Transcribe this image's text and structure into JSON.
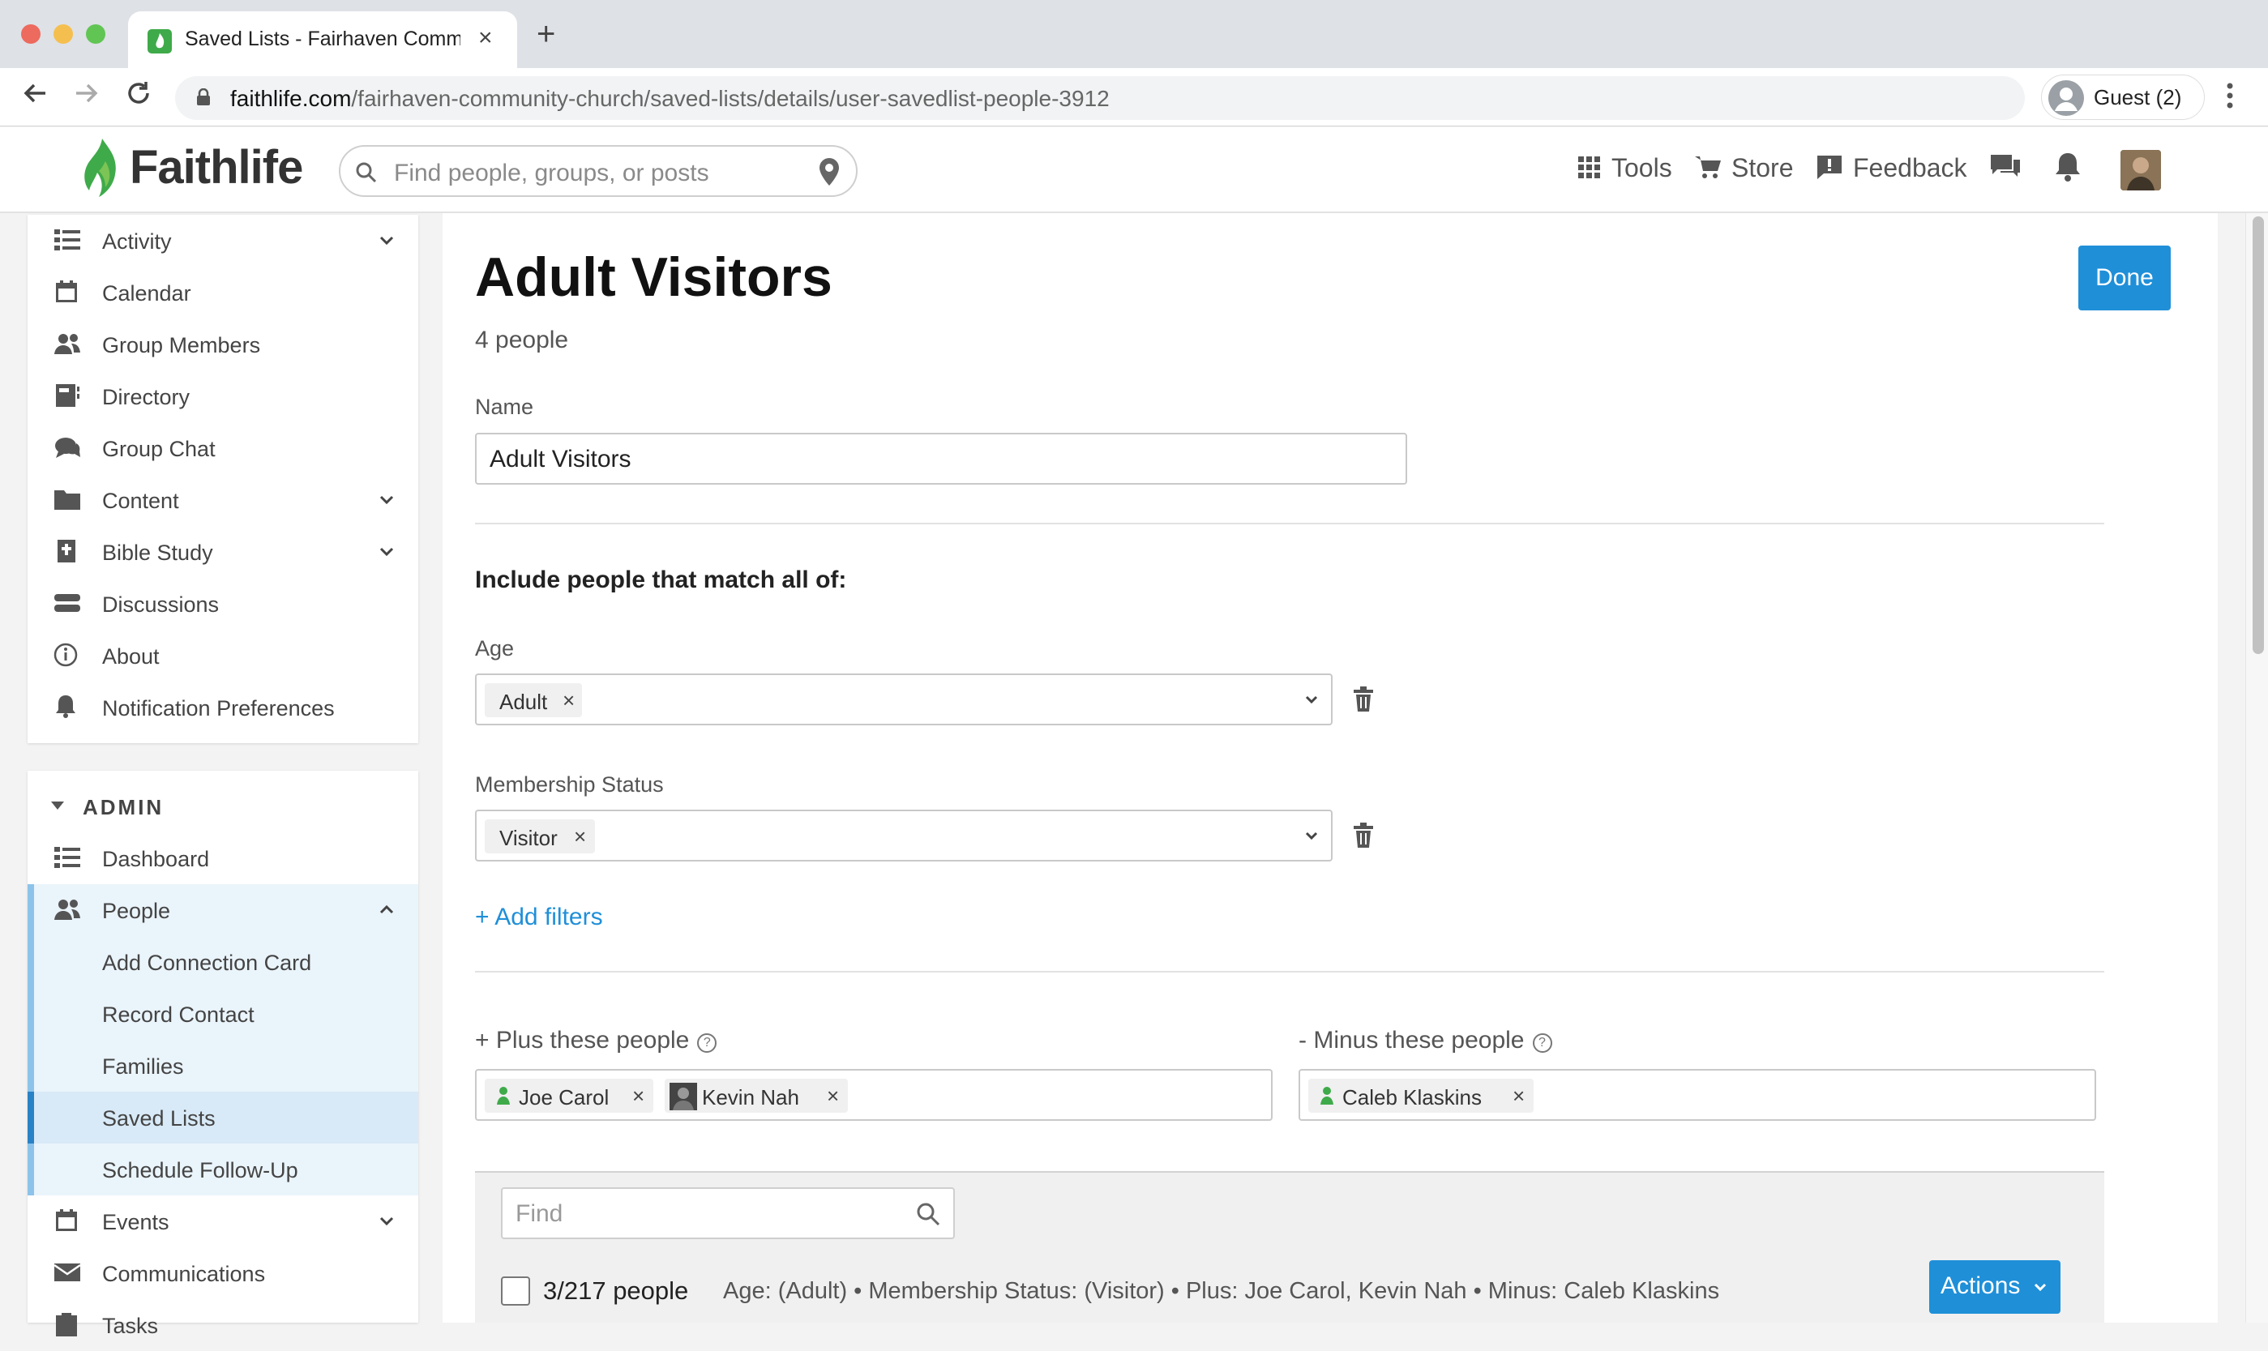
{
  "browser": {
    "tab_title": "Saved Lists - Fairhaven Community Church",
    "url_domain": "faithlife.com",
    "url_path": "/fairhaven-community-church/saved-lists/details/user-savedlist-people-3912",
    "profile_label": "Guest (2)"
  },
  "header": {
    "logo_text": "Faithlife",
    "search_placeholder": "Find people, groups, or posts",
    "nav": {
      "tools": "Tools",
      "store": "Store",
      "feedback": "Feedback"
    }
  },
  "sidebar": {
    "items": [
      {
        "label": "Activity"
      },
      {
        "label": "Calendar"
      },
      {
        "label": "Group Members"
      },
      {
        "label": "Directory"
      },
      {
        "label": "Group Chat"
      },
      {
        "label": "Content"
      },
      {
        "label": "Bible Study"
      },
      {
        "label": "Discussions"
      },
      {
        "label": "About"
      },
      {
        "label": "Notification Preferences"
      }
    ],
    "admin_title": "ADMIN",
    "admin_items": [
      {
        "label": "Dashboard"
      },
      {
        "label": "People"
      },
      {
        "label": "Add Connection Card"
      },
      {
        "label": "Record Contact"
      },
      {
        "label": "Families"
      },
      {
        "label": "Saved Lists"
      },
      {
        "label": "Schedule Follow-Up"
      },
      {
        "label": "Events"
      },
      {
        "label": "Communications"
      },
      {
        "label": "Tasks"
      }
    ]
  },
  "main": {
    "title": "Adult Visitors",
    "subtitle": "4 people",
    "done_label": "Done",
    "name_label": "Name",
    "name_value": "Adult Visitors",
    "include_heading": "Include people that match all of:",
    "filters": [
      {
        "label": "Age",
        "chip": "Adult"
      },
      {
        "label": "Membership Status",
        "chip": "Visitor"
      }
    ],
    "add_filters_label": "+ Add filters",
    "plus_label": "+ Plus these people",
    "minus_label": "- Minus these people",
    "plus_people": [
      "Joe Carol",
      "Kevin Nah"
    ],
    "minus_people": [
      "Caleb Klaskins"
    ],
    "find_placeholder": "Find",
    "count_text": "3/217 people",
    "summary_text": "Age: (Adult) • Membership Status: (Visitor) • Plus: Joe Carol, Kevin Nah • Minus: Caleb Klaskins",
    "actions_label": "Actions"
  },
  "colors": {
    "accent": "#1f8fd8",
    "brand_green": "#3faa4a",
    "sidebar_active": "#d8eaf7"
  }
}
